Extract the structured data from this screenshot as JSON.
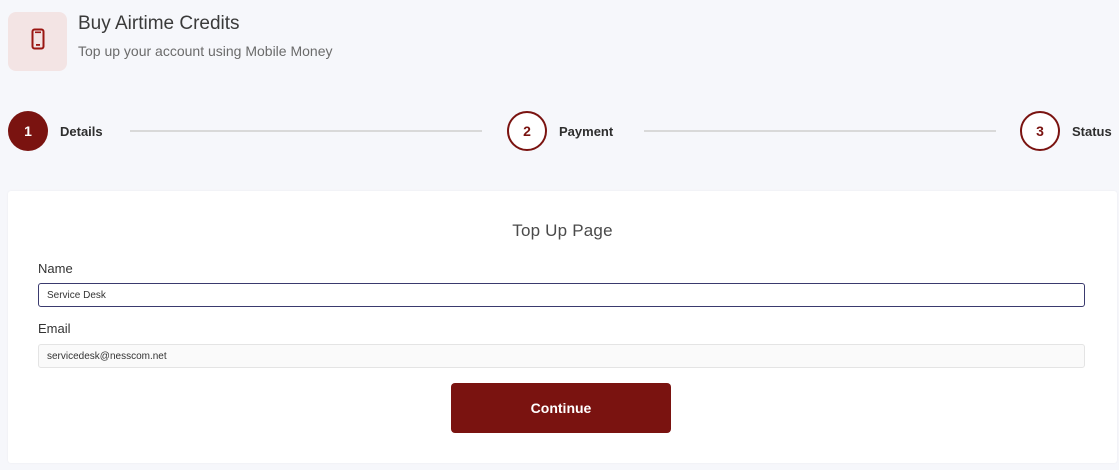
{
  "header": {
    "icon": "mobile-phone-icon",
    "title": "Buy Airtime Credits",
    "subtitle": "Top up your account using Mobile Money"
  },
  "stepper": {
    "steps": [
      {
        "number": "1",
        "label": "Details",
        "state": "active"
      },
      {
        "number": "2",
        "label": "Payment",
        "state": "inactive"
      },
      {
        "number": "3",
        "label": "Status",
        "state": "inactive"
      }
    ]
  },
  "form": {
    "title": "Top Up Page",
    "name_label": "Name",
    "name_value": "Service Desk",
    "email_label": "Email",
    "email_value": "servicedesk@nesscom.net",
    "continue_label": "Continue"
  },
  "colors": {
    "accent": "#7a1310",
    "icon_bg": "#f3e4e4",
    "page_bg": "#f6f7fb"
  }
}
